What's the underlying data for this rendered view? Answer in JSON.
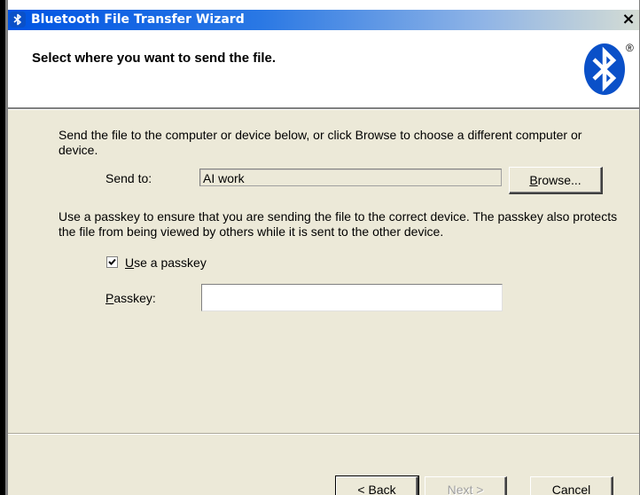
{
  "window": {
    "title": "Bluetooth File Transfer Wizard",
    "close_glyph": "×",
    "title_icon": "bluetooth-icon"
  },
  "header": {
    "title": "Select where you want to send the file.",
    "logo": "bluetooth-logo",
    "registered_mark": "®"
  },
  "body": {
    "intro": "Send the file to the computer or device below, or click Browse to choose a different computer or device.",
    "send_to_label": "Send to:",
    "send_to_value": "AI work",
    "browse_label": "Browse...",
    "passkey_description": "Use a passkey to ensure that you are sending the file to the correct device. The passkey also protects the file from being viewed by others while it is sent to the other device.",
    "use_passkey_label": "Use a passkey",
    "use_passkey_checked": true,
    "passkey_label": "Passkey:",
    "passkey_value": ""
  },
  "footer": {
    "back_label": "< Back",
    "next_label": "Next >",
    "cancel_label": "Cancel"
  },
  "colors": {
    "dialog_face": "#ece9d8",
    "title_bar_start": "#0054e3",
    "bluetooth_blue": "#0a50c8"
  }
}
